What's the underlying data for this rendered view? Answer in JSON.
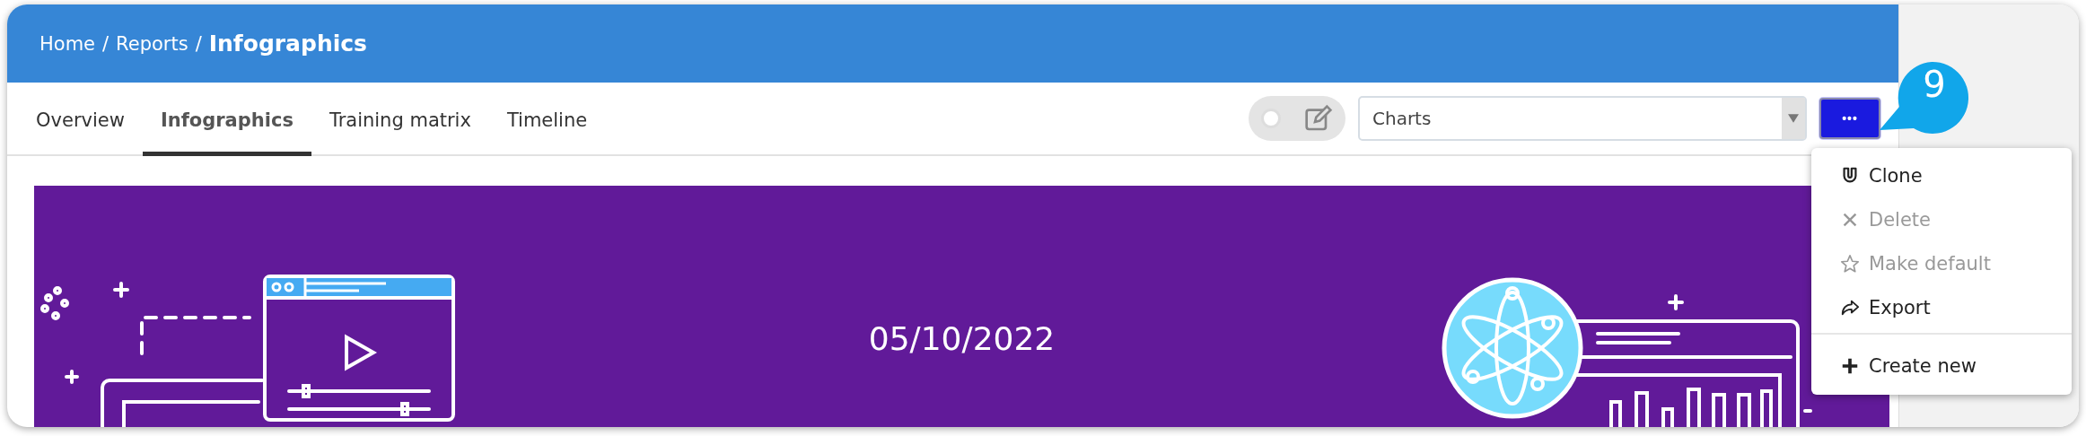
{
  "breadcrumb": [
    {
      "label": "Home",
      "current": false
    },
    {
      "label": "Reports",
      "current": false
    },
    {
      "label": "Infographics",
      "current": true
    }
  ],
  "breadcrumb_separator": "/",
  "tabs": [
    {
      "label": "Overview",
      "selected": false
    },
    {
      "label": "Infographics",
      "selected": true
    },
    {
      "label": "Training matrix",
      "selected": false
    },
    {
      "label": "Timeline",
      "selected": false
    }
  ],
  "edit_toggle": {
    "on": false
  },
  "view_select": {
    "value": "Charts"
  },
  "more_button": {
    "label": "•••",
    "expanded": true
  },
  "step_badge": "9",
  "menu": {
    "items": [
      {
        "label": "Clone",
        "kind": "magnet",
        "disabled": false,
        "divider_before": false
      },
      {
        "label": "Delete",
        "kind": "cross",
        "disabled": true,
        "divider_before": false
      },
      {
        "label": "Make default",
        "kind": "star",
        "disabled": true,
        "divider_before": false
      },
      {
        "label": "Export",
        "kind": "share",
        "disabled": false,
        "divider_before": false
      },
      {
        "label": "Create new",
        "kind": "plus",
        "disabled": false,
        "divider_before": true
      }
    ]
  },
  "banner": {
    "date": "05/10/2022"
  }
}
